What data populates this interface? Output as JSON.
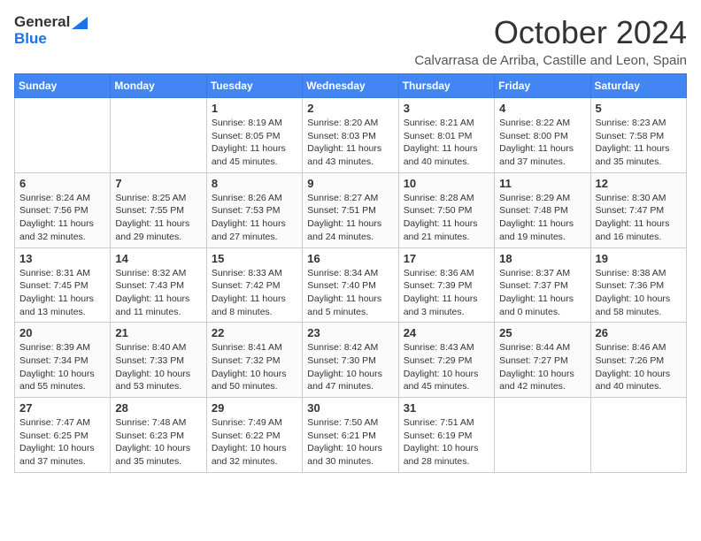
{
  "logo": {
    "line1": "General",
    "line2": "Blue"
  },
  "title": "October 2024",
  "location": "Calvarrasa de Arriba, Castille and Leon, Spain",
  "days_of_week": [
    "Sunday",
    "Monday",
    "Tuesday",
    "Wednesday",
    "Thursday",
    "Friday",
    "Saturday"
  ],
  "weeks": [
    [
      {
        "day": "",
        "info": ""
      },
      {
        "day": "",
        "info": ""
      },
      {
        "day": "1",
        "info": "Sunrise: 8:19 AM\nSunset: 8:05 PM\nDaylight: 11 hours and 45 minutes."
      },
      {
        "day": "2",
        "info": "Sunrise: 8:20 AM\nSunset: 8:03 PM\nDaylight: 11 hours and 43 minutes."
      },
      {
        "day": "3",
        "info": "Sunrise: 8:21 AM\nSunset: 8:01 PM\nDaylight: 11 hours and 40 minutes."
      },
      {
        "day": "4",
        "info": "Sunrise: 8:22 AM\nSunset: 8:00 PM\nDaylight: 11 hours and 37 minutes."
      },
      {
        "day": "5",
        "info": "Sunrise: 8:23 AM\nSunset: 7:58 PM\nDaylight: 11 hours and 35 minutes."
      }
    ],
    [
      {
        "day": "6",
        "info": "Sunrise: 8:24 AM\nSunset: 7:56 PM\nDaylight: 11 hours and 32 minutes."
      },
      {
        "day": "7",
        "info": "Sunrise: 8:25 AM\nSunset: 7:55 PM\nDaylight: 11 hours and 29 minutes."
      },
      {
        "day": "8",
        "info": "Sunrise: 8:26 AM\nSunset: 7:53 PM\nDaylight: 11 hours and 27 minutes."
      },
      {
        "day": "9",
        "info": "Sunrise: 8:27 AM\nSunset: 7:51 PM\nDaylight: 11 hours and 24 minutes."
      },
      {
        "day": "10",
        "info": "Sunrise: 8:28 AM\nSunset: 7:50 PM\nDaylight: 11 hours and 21 minutes."
      },
      {
        "day": "11",
        "info": "Sunrise: 8:29 AM\nSunset: 7:48 PM\nDaylight: 11 hours and 19 minutes."
      },
      {
        "day": "12",
        "info": "Sunrise: 8:30 AM\nSunset: 7:47 PM\nDaylight: 11 hours and 16 minutes."
      }
    ],
    [
      {
        "day": "13",
        "info": "Sunrise: 8:31 AM\nSunset: 7:45 PM\nDaylight: 11 hours and 13 minutes."
      },
      {
        "day": "14",
        "info": "Sunrise: 8:32 AM\nSunset: 7:43 PM\nDaylight: 11 hours and 11 minutes."
      },
      {
        "day": "15",
        "info": "Sunrise: 8:33 AM\nSunset: 7:42 PM\nDaylight: 11 hours and 8 minutes."
      },
      {
        "day": "16",
        "info": "Sunrise: 8:34 AM\nSunset: 7:40 PM\nDaylight: 11 hours and 5 minutes."
      },
      {
        "day": "17",
        "info": "Sunrise: 8:36 AM\nSunset: 7:39 PM\nDaylight: 11 hours and 3 minutes."
      },
      {
        "day": "18",
        "info": "Sunrise: 8:37 AM\nSunset: 7:37 PM\nDaylight: 11 hours and 0 minutes."
      },
      {
        "day": "19",
        "info": "Sunrise: 8:38 AM\nSunset: 7:36 PM\nDaylight: 10 hours and 58 minutes."
      }
    ],
    [
      {
        "day": "20",
        "info": "Sunrise: 8:39 AM\nSunset: 7:34 PM\nDaylight: 10 hours and 55 minutes."
      },
      {
        "day": "21",
        "info": "Sunrise: 8:40 AM\nSunset: 7:33 PM\nDaylight: 10 hours and 53 minutes."
      },
      {
        "day": "22",
        "info": "Sunrise: 8:41 AM\nSunset: 7:32 PM\nDaylight: 10 hours and 50 minutes."
      },
      {
        "day": "23",
        "info": "Sunrise: 8:42 AM\nSunset: 7:30 PM\nDaylight: 10 hours and 47 minutes."
      },
      {
        "day": "24",
        "info": "Sunrise: 8:43 AM\nSunset: 7:29 PM\nDaylight: 10 hours and 45 minutes."
      },
      {
        "day": "25",
        "info": "Sunrise: 8:44 AM\nSunset: 7:27 PM\nDaylight: 10 hours and 42 minutes."
      },
      {
        "day": "26",
        "info": "Sunrise: 8:46 AM\nSunset: 7:26 PM\nDaylight: 10 hours and 40 minutes."
      }
    ],
    [
      {
        "day": "27",
        "info": "Sunrise: 7:47 AM\nSunset: 6:25 PM\nDaylight: 10 hours and 37 minutes."
      },
      {
        "day": "28",
        "info": "Sunrise: 7:48 AM\nSunset: 6:23 PM\nDaylight: 10 hours and 35 minutes."
      },
      {
        "day": "29",
        "info": "Sunrise: 7:49 AM\nSunset: 6:22 PM\nDaylight: 10 hours and 32 minutes."
      },
      {
        "day": "30",
        "info": "Sunrise: 7:50 AM\nSunset: 6:21 PM\nDaylight: 10 hours and 30 minutes."
      },
      {
        "day": "31",
        "info": "Sunrise: 7:51 AM\nSunset: 6:19 PM\nDaylight: 10 hours and 28 minutes."
      },
      {
        "day": "",
        "info": ""
      },
      {
        "day": "",
        "info": ""
      }
    ]
  ]
}
